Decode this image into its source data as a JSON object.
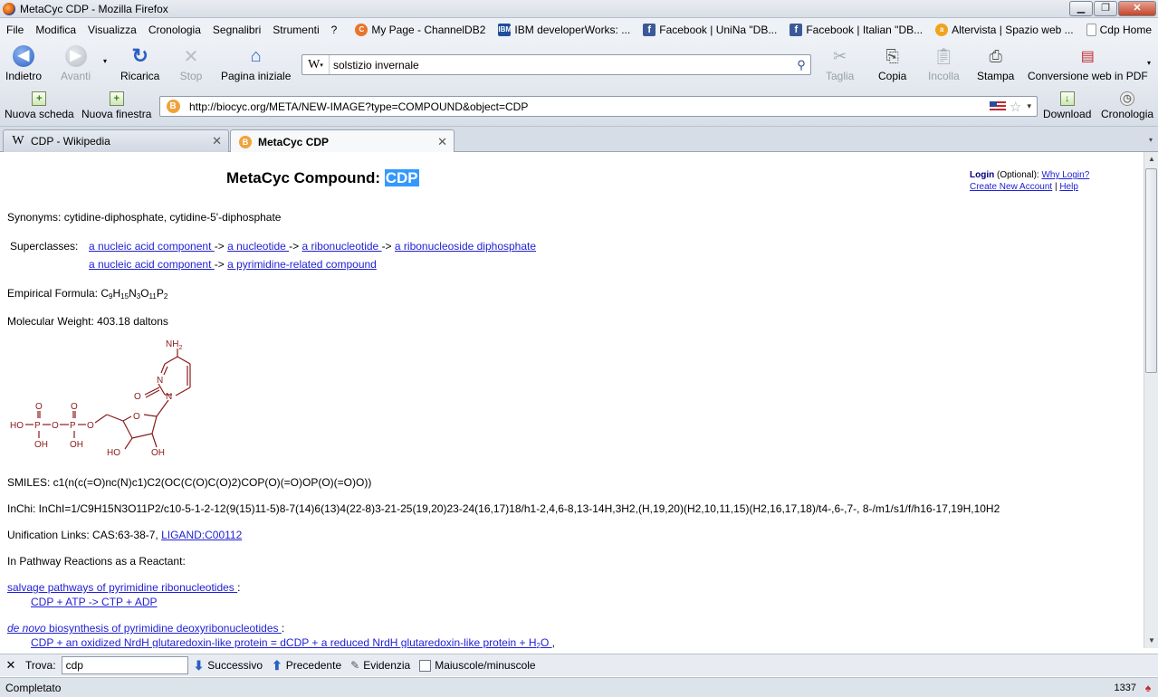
{
  "window": {
    "title": "MetaCyc CDP - Mozilla Firefox"
  },
  "menu": {
    "items": [
      {
        "label": "File"
      },
      {
        "label": "Modifica"
      },
      {
        "label": "Visualizza"
      },
      {
        "label": "Cronologia"
      },
      {
        "label": "Segnalibri"
      },
      {
        "label": "Strumenti"
      },
      {
        "label": "?"
      }
    ],
    "bookmarks": [
      {
        "label": "My Page - ChannelDB2",
        "icon": "channeldb2-icon",
        "color": "#e8752a"
      },
      {
        "label": "IBM developerWorks: ...",
        "icon": "ibm-icon",
        "color": "#1f4e9c"
      },
      {
        "label": "Facebook | UniNa \"DB...",
        "icon": "facebook-icon",
        "color": "#3b5998"
      },
      {
        "label": "Facebook | Italian \"DB...",
        "icon": "facebook-icon",
        "color": "#3b5998"
      },
      {
        "label": "Altervista | Spazio web ...",
        "icon": "altervista-icon",
        "color": "#f1a31d"
      },
      {
        "label": "Cdp Home",
        "icon": "page-icon",
        "color": "#ffffff"
      }
    ]
  },
  "toolbar": {
    "back": "Indietro",
    "forward": "Avanti",
    "reload": "Ricarica",
    "stop": "Stop",
    "home": "Pagina iniziale",
    "search_engine": "W",
    "search_value": "solstizio invernale",
    "cut": "Taglia",
    "copy": "Copia",
    "paste": "Incolla",
    "print": "Stampa",
    "pdf": "Conversione web in PDF"
  },
  "urlbar": {
    "new_tab": "Nuova scheda",
    "new_window": "Nuova finestra",
    "url": "http://biocyc.org/META/NEW-IMAGE?type=COMPOUND&object=CDP",
    "download": "Download",
    "history": "Cronologia"
  },
  "tabs": [
    {
      "label": "CDP - Wikipedia",
      "active": false,
      "icon": "wikipedia-icon"
    },
    {
      "label": "MetaCyc CDP",
      "active": true,
      "icon": "biocyc-icon"
    }
  ],
  "page": {
    "heading_prefix": "MetaCyc Compound: ",
    "heading_highlight": "CDP",
    "login": "Login",
    "optional": " (Optional):  ",
    "why_login": "Why Login?",
    "create_account": "Create New Account",
    "sep": " | ",
    "help": "Help",
    "synonyms": "Synonyms: cytidine-diphosphate, cytidine-5'-diphosphate",
    "superclasses_label": "Superclasses:",
    "superclass_row1": [
      "a nucleic acid component ",
      "a nucleotide ",
      "a ribonucleotide ",
      "a ribonucleoside diphosphate"
    ],
    "superclass_row2": [
      "a nucleic acid component ",
      "a pyrimidine-related compound"
    ],
    "arrow": " -> ",
    "formula_label": "Empirical Formula: ",
    "formula": [
      {
        "t": "C"
      },
      {
        "s": "9"
      },
      {
        "t": "H"
      },
      {
        "s": "15"
      },
      {
        "t": "N"
      },
      {
        "s": "3"
      },
      {
        "t": "O"
      },
      {
        "s": "11"
      },
      {
        "t": "P"
      },
      {
        "s": "2"
      }
    ],
    "mw": "Molecular Weight: 403.18 daltons",
    "structure": {
      "nh2": "NH2",
      "n": "N",
      "o": "O",
      "oh": "OH",
      "ho": "HO",
      "p": "P",
      "hyphen": "-"
    },
    "smiles": "SMILES: c1(n(c(=O)nc(N)c1)C2(OC(C(O)C(O)2)COP(O)(=O)OP(O)(=O)O))",
    "inchi": "InChi: InChI=1/C9H15N3O11P2/c10-5-1-2-12(9(15)11-5)8-7(14)6(13)4(22-8)3-21-25(19,20)23-24(16,17)18/h1-2,4,6-8,13-14H,3H2,(H,19,20)(H2,10,11,15)(H2,16,17,18)/t4-,6-,7-, 8-/m1/s1/f/h16-17,19H,10H2",
    "unification_label": "Unification Links: CAS:63-38-7, ",
    "unification_link": "LIGAND:C00112",
    "pathways_label": "In Pathway Reactions as a Reactant:",
    "pathway1": "salvage pathways of pyrimidine ribonucleotides ",
    "pathway1_colon": ":",
    "reaction1": "CDP + ATP -> CTP + ADP",
    "pathway2_italic": "de novo",
    "pathway2": " biosynthesis of pyrimidine deoxyribonucleotides ",
    "pathway2_colon": ":",
    "reaction2_a": "CDP + an oxidized NrdH glutaredoxin-like protein = dCDP + a reduced NrdH glutaredoxin-like protein + H",
    "reaction2_sub": "2",
    "reaction2_b": "O ",
    "reaction2_tail": ","
  },
  "findbar": {
    "label": "Trova:",
    "value": "cdp",
    "next": "Successivo",
    "prev": "Precedente",
    "highlight": "Evidenzia",
    "case": "Maiuscole/minuscole"
  },
  "status": {
    "text": "Completato",
    "right": "1337"
  },
  "colors": {
    "structure": "#8b1a1a",
    "link": "#2121d6",
    "highlight": "#3399ff"
  }
}
